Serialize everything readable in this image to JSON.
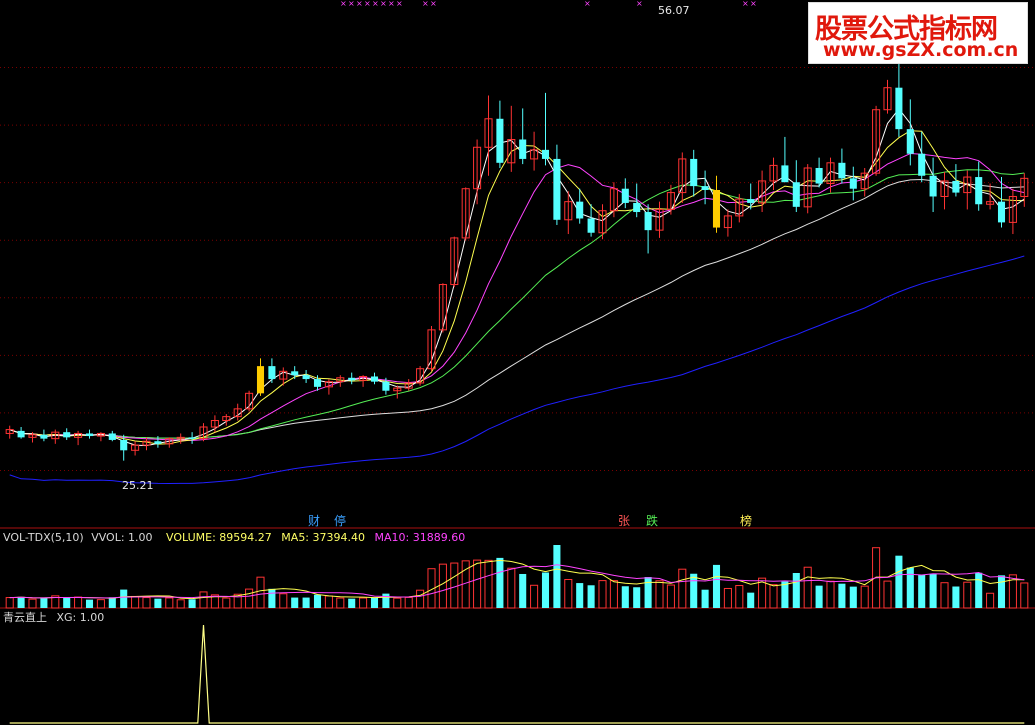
{
  "watermark": {
    "line1": "股票公式指标网",
    "line2": "www.gsZX.com.cn"
  },
  "colors": {
    "background": "#000000",
    "up_candle": "#ff3333",
    "down_candle": "#54ffff",
    "ma_white": "#ffffff",
    "ma_yellow": "#ffff4f",
    "ma_magenta": "#ff44ff",
    "ma_green": "#55ee55",
    "ma_long": "#dddddd",
    "ma_blue": "#2020ff",
    "signal_bar": "#ffcc00",
    "grid": "#7a0000"
  },
  "main_panel": {
    "price_high_label": "56.07",
    "price_low_label": "25.21",
    "event_markers": [
      {
        "text": "财",
        "color": "#3aa0ff"
      },
      {
        "text": "停",
        "color": "#3aa0ff"
      },
      {
        "text": "张",
        "color": "#ff5555"
      },
      {
        "text": "跌",
        "color": "#55ee55"
      },
      {
        "text": "榜",
        "color": "#ffee55"
      }
    ]
  },
  "volume_panel": {
    "title": "VOL-TDX(5,10)",
    "vvol": "VVOL: 1.00",
    "volume": "VOLUME: 89594.27",
    "ma5": "MA5: 37394.40",
    "ma10": "MA10: 31889.60"
  },
  "indicator_panel": {
    "name": "青云直上",
    "xg": "XG: 1.00"
  },
  "chart_data": {
    "type": "candlestick",
    "y_range": [
      20,
      60
    ],
    "highest_price": 56.07,
    "lowest_price": 25.21,
    "signal_candle_indices": [
      22,
      62,
      99
    ],
    "indicator_spike_indices": [
      17,
      99
    ],
    "volume_latest": 89594.27,
    "volume_ma5": 37394.4,
    "volume_ma10": 31889.6,
    "xg": 1.0,
    "candles": [
      [
        27.3,
        27.9,
        26.9,
        27.6
      ],
      [
        27.5,
        27.8,
        26.9,
        27.0
      ],
      [
        27.0,
        27.4,
        26.6,
        27.2
      ],
      [
        27.2,
        27.6,
        26.7,
        26.9
      ],
      [
        26.9,
        27.6,
        26.5,
        27.4
      ],
      [
        27.4,
        27.7,
        26.8,
        27.0
      ],
      [
        27.0,
        27.5,
        26.4,
        27.3
      ],
      [
        27.3,
        27.6,
        26.9,
        27.1
      ],
      [
        27.1,
        27.4,
        26.7,
        27.3
      ],
      [
        27.3,
        27.5,
        26.7,
        26.8
      ],
      [
        26.8,
        27.2,
        25.2,
        26.0
      ],
      [
        26.0,
        26.7,
        25.6,
        26.4
      ],
      [
        26.4,
        27.0,
        26.0,
        26.7
      ],
      [
        26.7,
        27.1,
        26.2,
        26.5
      ],
      [
        26.5,
        27.0,
        26.2,
        26.9
      ],
      [
        26.9,
        27.3,
        26.5,
        27.0
      ],
      [
        27.0,
        27.4,
        26.5,
        26.9
      ],
      [
        26.9,
        28.1,
        26.7,
        27.8
      ],
      [
        27.8,
        28.7,
        27.4,
        28.3
      ],
      [
        28.3,
        28.8,
        27.9,
        28.6
      ],
      [
        28.6,
        29.6,
        28.3,
        29.2
      ],
      [
        29.2,
        30.6,
        29.0,
        30.4
      ],
      [
        30.4,
        33.1,
        30.2,
        32.5
      ],
      [
        32.5,
        33.1,
        31.2,
        31.5
      ],
      [
        31.5,
        32.4,
        31.0,
        32.1
      ],
      [
        32.1,
        32.5,
        31.5,
        31.8
      ],
      [
        31.8,
        32.2,
        31.2,
        31.5
      ],
      [
        31.5,
        31.8,
        30.6,
        30.9
      ],
      [
        30.9,
        31.5,
        30.3,
        31.3
      ],
      [
        31.3,
        31.8,
        30.9,
        31.6
      ],
      [
        31.6,
        32.0,
        31.1,
        31.4
      ],
      [
        31.4,
        31.8,
        30.9,
        31.7
      ],
      [
        31.7,
        32.0,
        31.1,
        31.3
      ],
      [
        31.3,
        31.6,
        30.3,
        30.6
      ],
      [
        30.6,
        31.0,
        30.0,
        30.8
      ],
      [
        30.8,
        31.5,
        30.6,
        31.2
      ],
      [
        31.2,
        32.5,
        31.0,
        32.3
      ],
      [
        32.3,
        35.6,
        32.1,
        35.3
      ],
      [
        35.3,
        38.9,
        35.1,
        38.8
      ],
      [
        38.8,
        42.5,
        38.6,
        42.4
      ],
      [
        42.4,
        46.3,
        42.2,
        46.2
      ],
      [
        46.2,
        50.0,
        45.0,
        49.4
      ],
      [
        49.4,
        53.4,
        47.2,
        51.6
      ],
      [
        51.6,
        53.0,
        47.8,
        48.2
      ],
      [
        48.2,
        52.6,
        47.5,
        50.0
      ],
      [
        50.0,
        52.4,
        48.1,
        48.5
      ],
      [
        48.5,
        50.6,
        47.6,
        49.2
      ],
      [
        49.2,
        53.6,
        48.0,
        48.5
      ],
      [
        48.5,
        49.6,
        43.4,
        43.8
      ],
      [
        43.8,
        46.0,
        42.7,
        45.2
      ],
      [
        45.2,
        46.2,
        43.5,
        43.9
      ],
      [
        43.9,
        45.0,
        42.5,
        42.8
      ],
      [
        42.8,
        45.0,
        42.3,
        44.5
      ],
      [
        44.5,
        46.7,
        44.0,
        46.2
      ],
      [
        46.2,
        47.0,
        44.7,
        45.1
      ],
      [
        45.1,
        46.6,
        44.0,
        44.4
      ],
      [
        44.4,
        45.0,
        41.2,
        43.0
      ],
      [
        43.0,
        45.2,
        42.4,
        44.6
      ],
      [
        44.6,
        46.5,
        44.2,
        45.9
      ],
      [
        45.9,
        49.0,
        45.1,
        48.5
      ],
      [
        48.5,
        49.2,
        45.6,
        46.4
      ],
      [
        46.4,
        47.6,
        45.0,
        46.1
      ],
      [
        46.1,
        47.2,
        42.8,
        43.2
      ],
      [
        43.2,
        44.6,
        42.5,
        44.1
      ],
      [
        44.1,
        45.8,
        43.6,
        45.4
      ],
      [
        45.4,
        46.6,
        44.6,
        45.1
      ],
      [
        45.1,
        47.6,
        44.4,
        46.8
      ],
      [
        46.8,
        48.6,
        46.1,
        48.0
      ],
      [
        48.0,
        50.2,
        47.2,
        46.7
      ],
      [
        46.7,
        48.4,
        44.4,
        44.8
      ],
      [
        44.8,
        48.1,
        44.3,
        47.8
      ],
      [
        47.8,
        48.6,
        46.3,
        46.6
      ],
      [
        46.6,
        48.6,
        45.9,
        48.2
      ],
      [
        48.2,
        49.3,
        46.6,
        47.0
      ],
      [
        47.0,
        47.9,
        45.3,
        46.2
      ],
      [
        46.2,
        47.8,
        45.6,
        47.4
      ],
      [
        47.4,
        52.6,
        47.2,
        52.3
      ],
      [
        52.3,
        54.6,
        52.0,
        54.0
      ],
      [
        54.0,
        56.1,
        50.2,
        50.8
      ],
      [
        50.8,
        53.1,
        48.0,
        48.9
      ],
      [
        48.9,
        50.6,
        46.7,
        47.2
      ],
      [
        47.2,
        48.6,
        44.4,
        45.6
      ],
      [
        45.6,
        47.5,
        44.6,
        46.8
      ],
      [
        46.8,
        48.1,
        45.6,
        45.9
      ],
      [
        45.9,
        47.6,
        44.6,
        47.1
      ],
      [
        47.1,
        48.3,
        44.5,
        45.0
      ],
      [
        45.0,
        46.6,
        44.6,
        45.2
      ],
      [
        45.2,
        47.1,
        43.2,
        43.6
      ],
      [
        43.6,
        46.2,
        42.7,
        45.6
      ],
      [
        45.6,
        47.4,
        44.8,
        47.0
      ]
    ]
  }
}
